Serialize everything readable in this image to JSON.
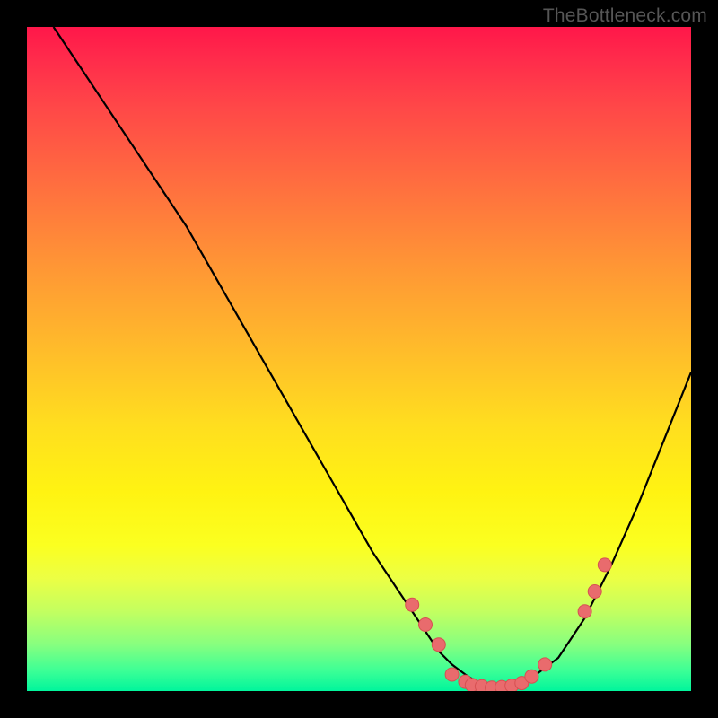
{
  "watermark": "TheBottleneck.com",
  "chart_data": {
    "type": "line",
    "title": "",
    "xlabel": "",
    "ylabel": "",
    "xlim": [
      0,
      100
    ],
    "ylim": [
      0,
      100
    ],
    "grid": false,
    "series": [
      {
        "name": "curve",
        "x": [
          4,
          8,
          12,
          16,
          20,
          24,
          28,
          32,
          36,
          40,
          44,
          48,
          52,
          56,
          60,
          62,
          64,
          66,
          68,
          70,
          72,
          76,
          80,
          84,
          88,
          92,
          96,
          100
        ],
        "y": [
          100,
          94,
          88,
          82,
          76,
          70,
          63,
          56,
          49,
          42,
          35,
          28,
          21,
          15,
          9,
          6,
          4,
          2.5,
          1.2,
          0.6,
          0.8,
          2,
          5,
          11,
          19,
          28,
          38,
          48
        ]
      }
    ],
    "points": [
      {
        "x": 58,
        "y": 13
      },
      {
        "x": 60,
        "y": 10
      },
      {
        "x": 62,
        "y": 7
      },
      {
        "x": 64,
        "y": 2.5
      },
      {
        "x": 66,
        "y": 1.4
      },
      {
        "x": 67,
        "y": 0.9
      },
      {
        "x": 68.5,
        "y": 0.7
      },
      {
        "x": 70,
        "y": 0.5
      },
      {
        "x": 71.5,
        "y": 0.6
      },
      {
        "x": 73,
        "y": 0.8
      },
      {
        "x": 74.5,
        "y": 1.2
      },
      {
        "x": 76,
        "y": 2.2
      },
      {
        "x": 78,
        "y": 4
      },
      {
        "x": 84,
        "y": 12
      },
      {
        "x": 85.5,
        "y": 15
      },
      {
        "x": 87,
        "y": 19
      }
    ],
    "colors": {
      "curve": "#000000",
      "dot_fill": "#e96b6d",
      "dot_stroke": "#d75052"
    }
  }
}
